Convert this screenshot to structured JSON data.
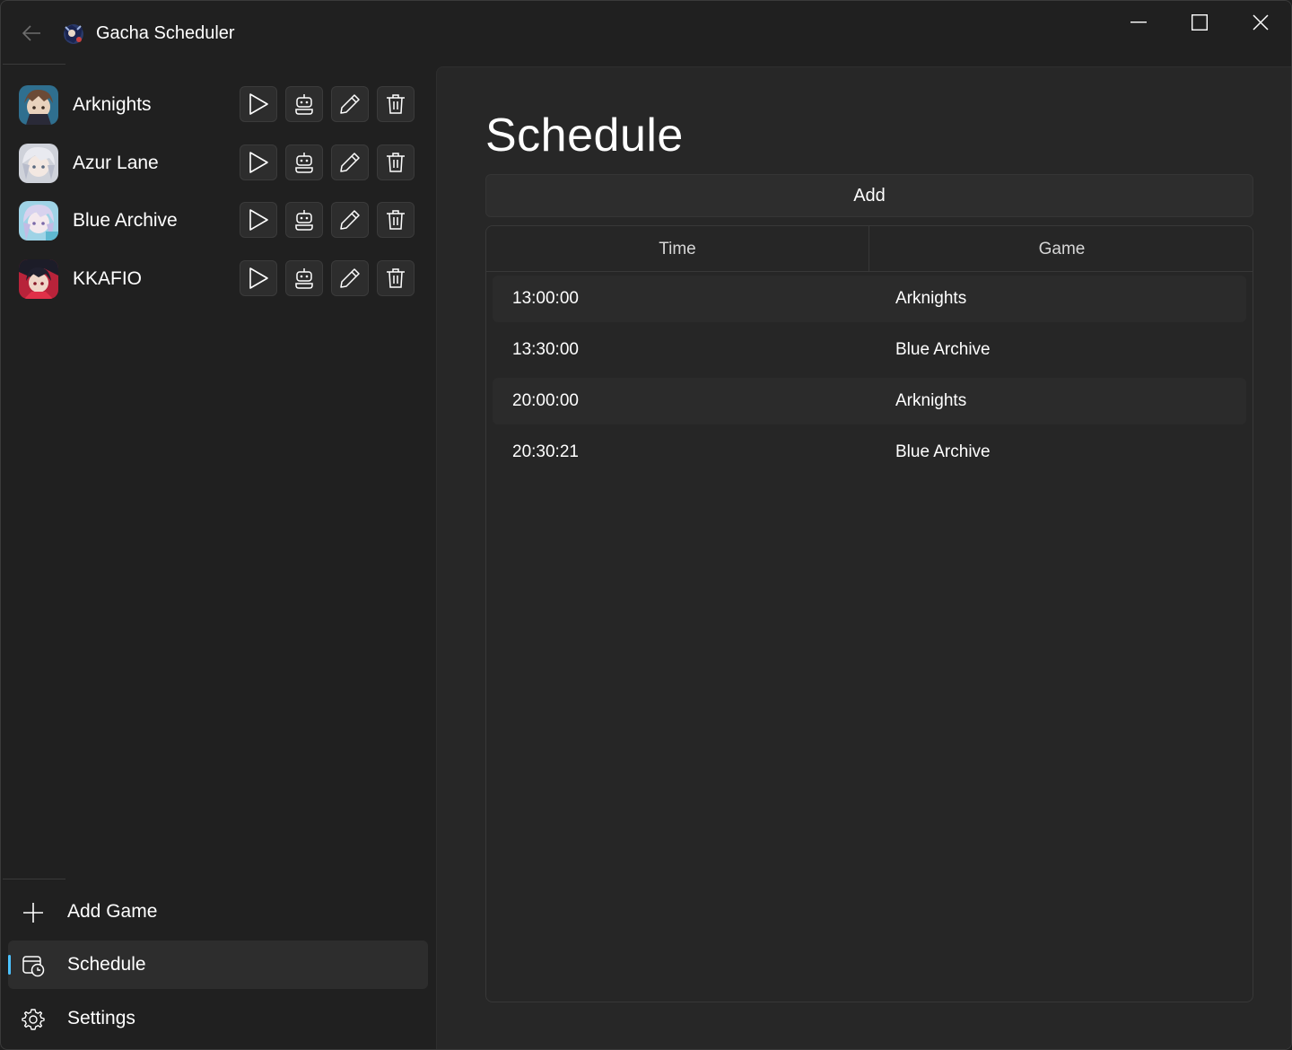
{
  "window": {
    "title": "Gacha Scheduler"
  },
  "sidebar": {
    "games": [
      {
        "name": "Arknights",
        "avatar_colors": [
          "#3b7fa3",
          "#7a5a45"
        ]
      },
      {
        "name": "Azur Lane",
        "avatar_colors": [
          "#d9d9e0",
          "#8a8a96"
        ]
      },
      {
        "name": "Blue Archive",
        "avatar_colors": [
          "#c9c4e8",
          "#6fb9d6"
        ]
      },
      {
        "name": "KKAFIO",
        "avatar_colors": [
          "#c2283d",
          "#1d1d2b"
        ]
      }
    ],
    "row_actions": [
      "play-icon",
      "robot-icon",
      "pencil-icon",
      "trash-icon"
    ],
    "nav": {
      "add_game": "Add Game",
      "schedule": "Schedule",
      "settings": "Settings"
    }
  },
  "main": {
    "title": "Schedule",
    "add_label": "Add",
    "table": {
      "columns": [
        "Time",
        "Game"
      ],
      "rows": [
        {
          "time": "13:00:00",
          "game": "Arknights"
        },
        {
          "time": "13:30:00",
          "game": "Blue Archive"
        },
        {
          "time": "20:00:00",
          "game": "Arknights"
        },
        {
          "time": "20:30:21",
          "game": "Blue Archive"
        }
      ]
    }
  },
  "colors": {
    "accent": "#4cc2ff",
    "background": "#202020",
    "content_bg": "#272727"
  }
}
